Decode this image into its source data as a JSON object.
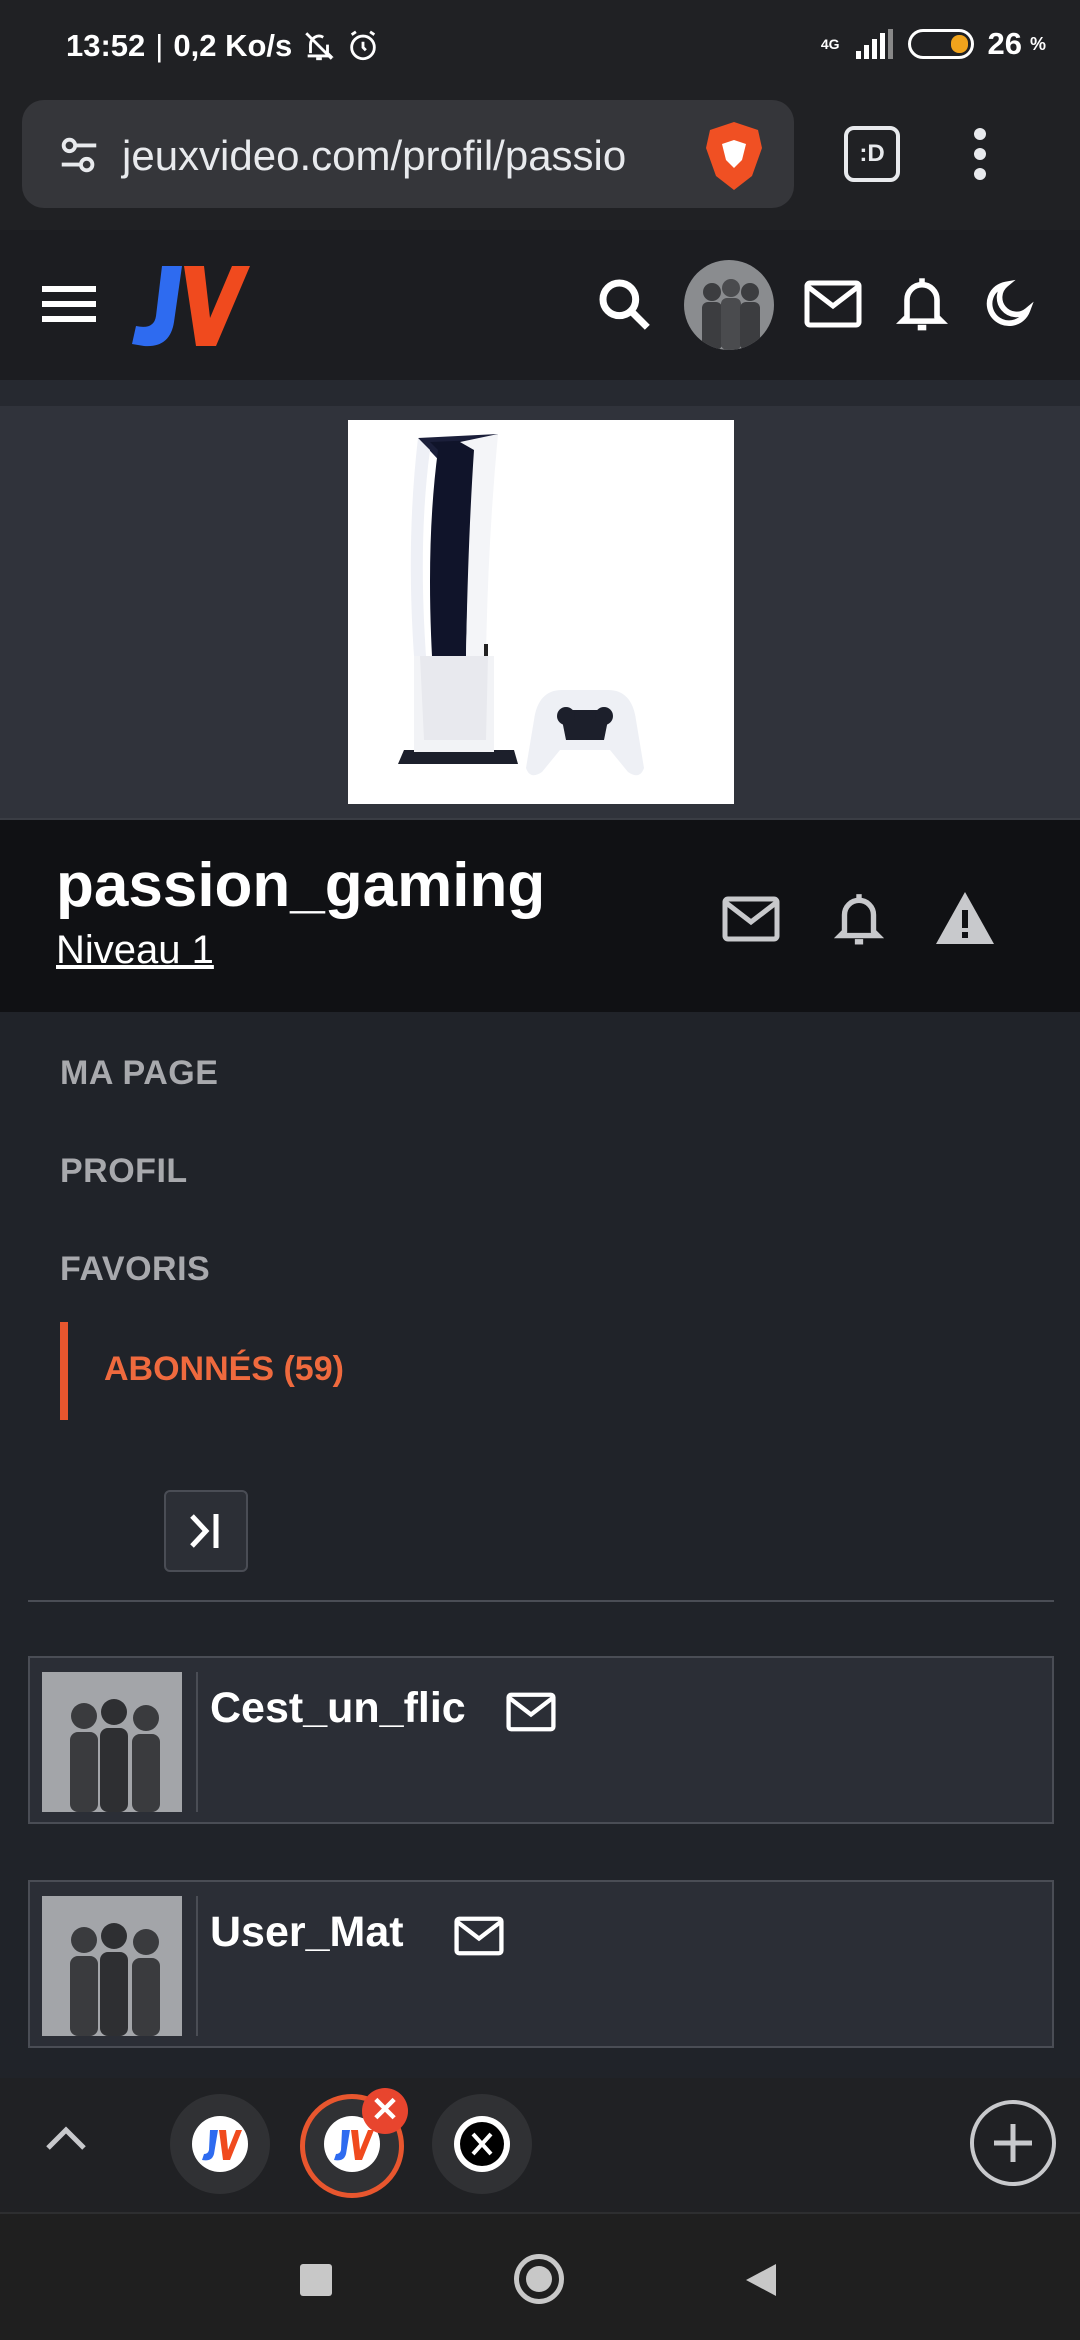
{
  "status_bar": {
    "time": "13:52",
    "separator": "|",
    "speed": "0,2 Ko/s",
    "network": "4G",
    "battery_level": "26",
    "battery_unit": "%"
  },
  "browser": {
    "url": "jeuxvideo.com/profil/passio",
    "tab_count_label": ":D"
  },
  "site": {
    "logo_text": "JV",
    "logo_colors": {
      "j": "#2e6bf0",
      "v": "#f04a1e"
    }
  },
  "profile": {
    "username": "passion_gaming",
    "level": "Niveau 1"
  },
  "nav": {
    "items": [
      "MA PAGE",
      "PROFIL",
      "FAVORIS"
    ],
    "active": "ABONNÉS (59)"
  },
  "followers": [
    {
      "name": "Cest_un_flic"
    },
    {
      "name": "User_Mat"
    }
  ],
  "tabs": {
    "close_label": "✕"
  },
  "colors": {
    "accent": "#e8562e",
    "background": "#202329",
    "header": "#1c1d21"
  }
}
